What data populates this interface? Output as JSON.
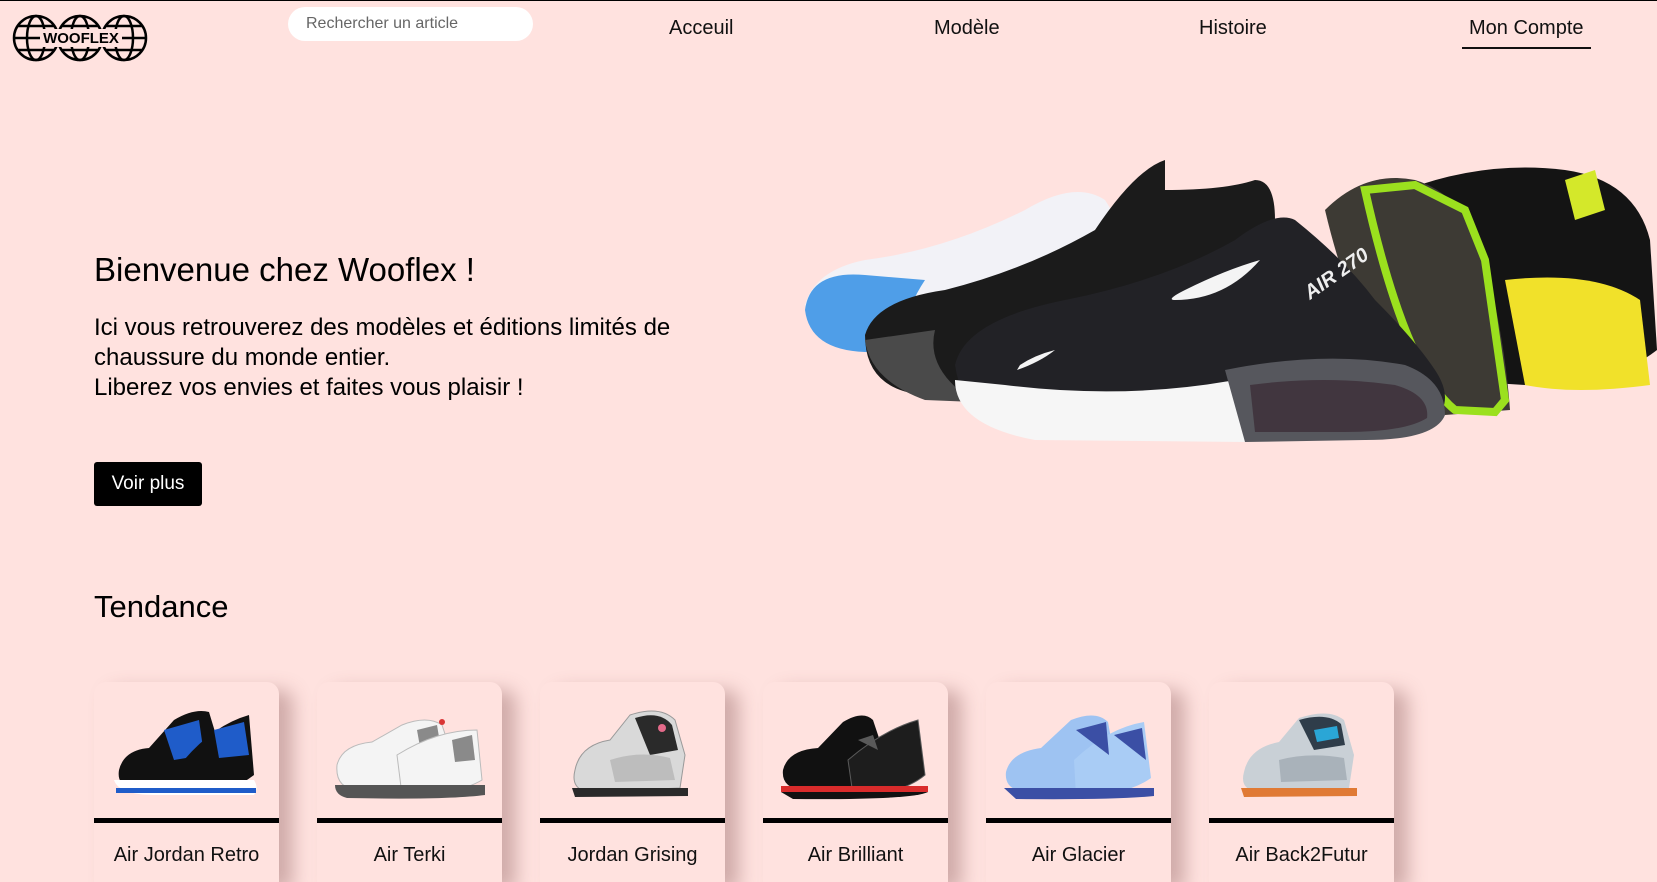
{
  "logo": {
    "text": "WOOFLEX"
  },
  "search": {
    "placeholder": "Rechercher un article"
  },
  "nav": {
    "items": [
      {
        "label": "Acceuil"
      },
      {
        "label": "Modèle"
      },
      {
        "label": "Histoire"
      },
      {
        "label": "Mon Compte",
        "active": true
      }
    ]
  },
  "hero": {
    "title": "Bienvenue chez Wooflex !",
    "text_lines": [
      "Ici vous retrouverez des modèles et éditions limités de",
      "chaussure du monde entier.",
      "Liberez vos envies et faites vous plaisir !"
    ],
    "button_label": "Voir plus",
    "image_text": "AIR 270"
  },
  "trending": {
    "title": "Tendance",
    "products": [
      {
        "name": "Air Jordan Retro",
        "colors": [
          "#1f5cc9",
          "#111111",
          "#ffffff"
        ]
      },
      {
        "name": "Air Terki",
        "colors": [
          "#f4f4f4",
          "#8a8a8a",
          "#d93535"
        ]
      },
      {
        "name": "Jordan Grising",
        "colors": [
          "#d9d9d9",
          "#2a2a2a",
          "#e46a8a"
        ]
      },
      {
        "name": "Air Brilliant",
        "colors": [
          "#111111",
          "#5a5a5a",
          "#d92b2b"
        ]
      },
      {
        "name": "Air Glacier",
        "colors": [
          "#9ec3f2",
          "#3b4fa5",
          "#ffffff"
        ]
      },
      {
        "name": "Air Back2Futur",
        "colors": [
          "#c9d0d6",
          "#2aa6d6",
          "#e07a35"
        ]
      }
    ]
  },
  "colors": {
    "background": "#ffe2df",
    "button": "#000000",
    "text": "#111111"
  }
}
